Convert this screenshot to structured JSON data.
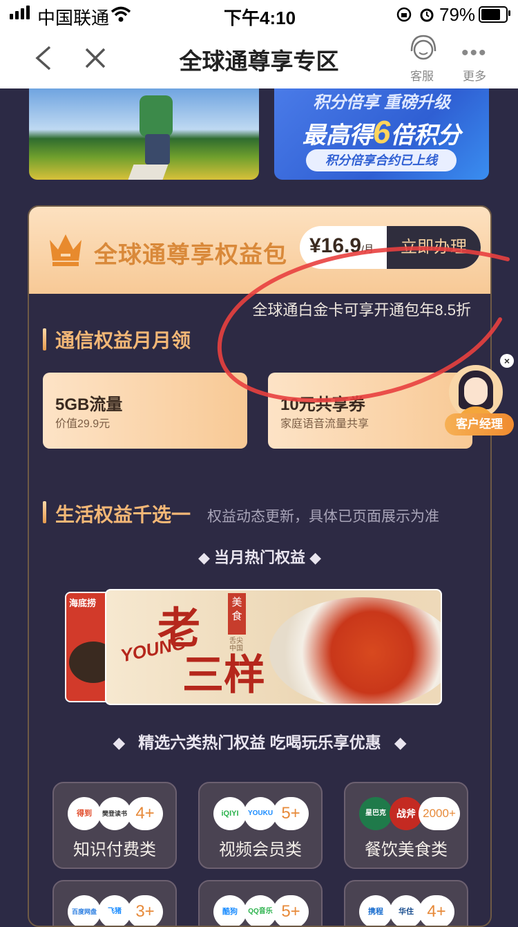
{
  "status_bar": {
    "carrier": "中国联通",
    "time": "下午4:10",
    "battery_percent": "79%",
    "battery_level": 0.79,
    "icons": [
      "signal-icon",
      "wifi-icon",
      "orientation-lock-icon",
      "alarm-icon",
      "battery-icon"
    ]
  },
  "navbar": {
    "title": "全球通尊享专区",
    "service_label": "客服",
    "more_label": "更多",
    "icons": [
      "back-icon",
      "close-icon",
      "customer-service-icon",
      "more-icon"
    ]
  },
  "banners": {
    "right": {
      "line1": "积分倍享 重磅升级",
      "line2_prefix": "最高得",
      "line2_num": "6",
      "line2_suffix": "倍积分",
      "pill": "积分倍享合约已上线"
    }
  },
  "package": {
    "title": "全球通尊享权益包",
    "price": "¥16.9",
    "price_unit": "/月",
    "apply_button": "立即办理",
    "discount_note": "全球通白金卡可享开通包年8.5折"
  },
  "comm_section": {
    "title": "通信权益月月领",
    "items": [
      {
        "title": "5GB流量",
        "sub": "价值29.9元"
      },
      {
        "title": "10元共享券",
        "sub": "家庭语音流量共享"
      }
    ]
  },
  "life_section": {
    "title": "生活权益千选一",
    "subtitle": "权益动态更新，具体已页面展示为准",
    "hot_title": "当月热门权益",
    "hot_banner": {
      "left_tag": "海底捞",
      "brand_line1": "老",
      "brand_line2": "三样",
      "brand_en": "YOUNG",
      "tag": "美食",
      "tag_sub": "舌尖中国"
    },
    "categories_title": "精选六类热门权益 吃喝玩乐享优惠",
    "categories": [
      {
        "label": "知识付费类",
        "count": "4+",
        "logos": [
          "得到",
          "樊登读书"
        ]
      },
      {
        "label": "视频会员类",
        "count": "5+",
        "logos": [
          "iQIYI",
          "YOUKU"
        ]
      },
      {
        "label": "餐饮美食类",
        "count": "2000+",
        "logos": [
          "星巴克",
          "战斧"
        ]
      },
      {
        "label": "",
        "count": "3+",
        "logos": [
          "百度网盘",
          "飞猪"
        ]
      },
      {
        "label": "",
        "count": "5+",
        "logos": [
          "酷狗",
          "QQ音乐"
        ]
      },
      {
        "label": "",
        "count": "4+",
        "logos": [
          "携程",
          "华住"
        ]
      }
    ]
  },
  "customer_manager": {
    "label": "客户经理",
    "close_icon": "close-icon"
  },
  "colors": {
    "page_bg": "#2c2a45",
    "accent": "#f3b776",
    "annotation": "#e8403f"
  }
}
